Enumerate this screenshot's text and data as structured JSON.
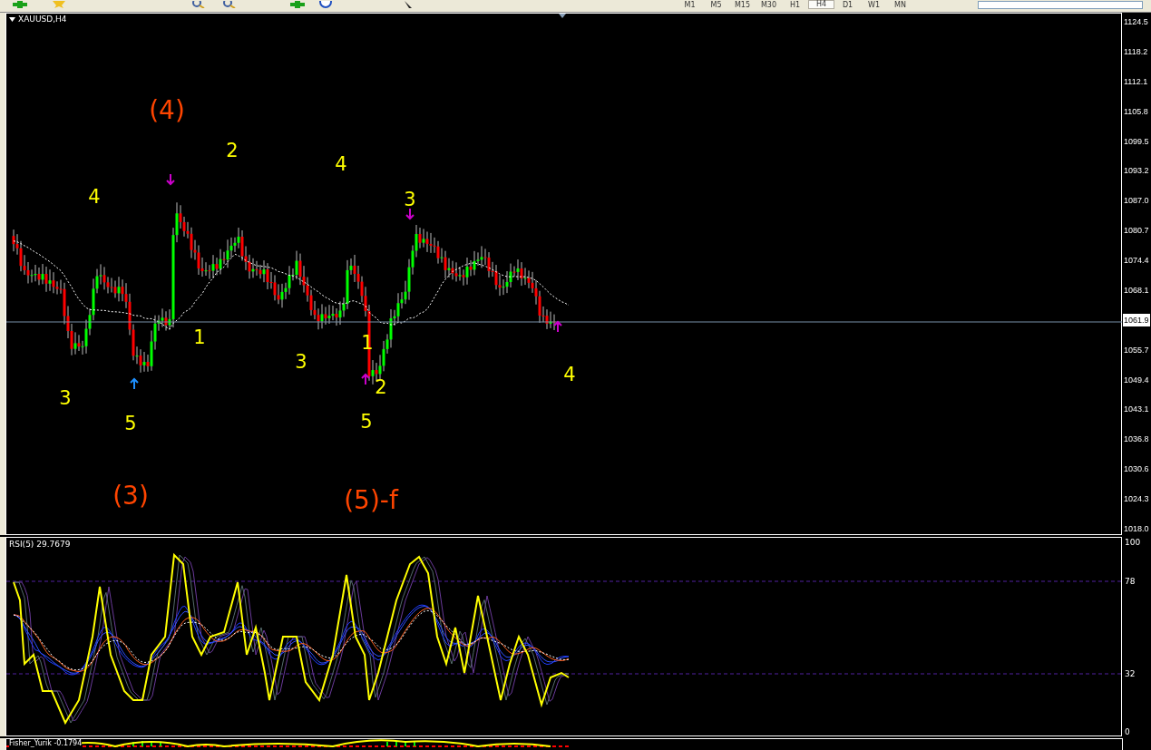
{
  "toolbar": {
    "timeframes": [
      {
        "label": "M1",
        "selected": false
      },
      {
        "label": "M5",
        "selected": false
      },
      {
        "label": "M15",
        "selected": false
      },
      {
        "label": "M30",
        "selected": false
      },
      {
        "label": "H1",
        "selected": false
      },
      {
        "label": "H4",
        "selected": true
      },
      {
        "label": "D1",
        "selected": false
      },
      {
        "label": "W1",
        "selected": false
      },
      {
        "label": "MN",
        "selected": false
      }
    ]
  },
  "main_chart": {
    "title": "XAUUSD,H4",
    "price_ticks": [
      {
        "label": "1124.5",
        "current": false
      },
      {
        "label": "1118.2",
        "current": false
      },
      {
        "label": "1112.1",
        "current": false
      },
      {
        "label": "1105.8",
        "current": false
      },
      {
        "label": "1099.5",
        "current": false
      },
      {
        "label": "1093.2",
        "current": false
      },
      {
        "label": "1087.0",
        "current": false
      },
      {
        "label": "1080.7",
        "current": false
      },
      {
        "label": "1074.4",
        "current": false
      },
      {
        "label": "1068.1",
        "current": false
      },
      {
        "label": "1061.9",
        "current": true
      },
      {
        "label": "1055.7",
        "current": false
      },
      {
        "label": "1049.4",
        "current": false
      },
      {
        "label": "1043.1",
        "current": false
      },
      {
        "label": "1036.8",
        "current": false
      },
      {
        "label": "1030.6",
        "current": false
      },
      {
        "label": "1024.3",
        "current": false
      },
      {
        "label": "1018.0",
        "current": false
      }
    ],
    "wave_labels": [
      {
        "text": "(4)",
        "color": "#ff4500",
        "kind": "major"
      },
      {
        "text": "2",
        "color": "#ffff00",
        "kind": "minor"
      },
      {
        "text": "4",
        "color": "#ffff00",
        "kind": "minor"
      },
      {
        "text": "4",
        "color": "#ffff00",
        "kind": "minor"
      },
      {
        "text": "3",
        "color": "#ffff00",
        "kind": "minor"
      },
      {
        "text": "1",
        "color": "#ffff00",
        "kind": "minor"
      },
      {
        "text": "1",
        "color": "#ffff00",
        "kind": "minor"
      },
      {
        "text": "3",
        "color": "#ffff00",
        "kind": "minor"
      },
      {
        "text": "2",
        "color": "#ffff00",
        "kind": "minor"
      },
      {
        "text": "3",
        "color": "#ffff00",
        "kind": "minor"
      },
      {
        "text": "5",
        "color": "#ffff00",
        "kind": "minor"
      },
      {
        "text": "5",
        "color": "#ffff00",
        "kind": "minor"
      },
      {
        "text": "4",
        "color": "#ffff00",
        "kind": "minor"
      },
      {
        "text": "(3)",
        "color": "#ff4500",
        "kind": "major"
      },
      {
        "text": "(5)-f",
        "color": "#ff4500",
        "kind": "major"
      }
    ],
    "signal_arrows": [
      {
        "kind": "down",
        "color": "#cc00cc"
      },
      {
        "kind": "down",
        "color": "#cc00cc"
      },
      {
        "kind": "up",
        "color": "#1e90ff"
      },
      {
        "kind": "up",
        "color": "#cc00cc"
      },
      {
        "kind": "up",
        "color": "#cc00cc"
      }
    ]
  },
  "rsi_panel": {
    "title": "RSI(5) 29.7679",
    "ticks": [
      "100",
      "78",
      "32",
      "0"
    ]
  },
  "fisher_panel": {
    "title": "Fisher_Yurik -0.1794"
  }
}
